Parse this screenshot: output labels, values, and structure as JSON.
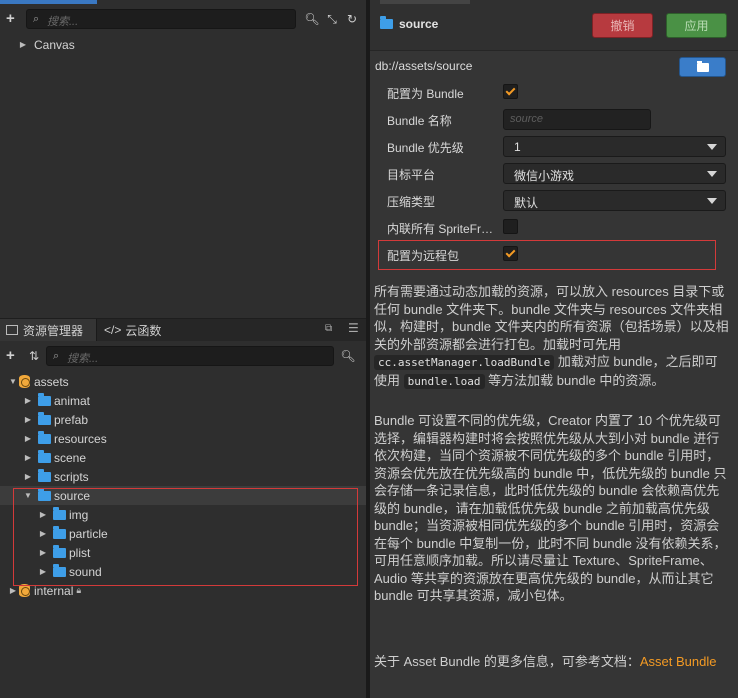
{
  "hierarchy": {
    "search_placeholder": "搜索...",
    "items": [
      {
        "label": "Canvas"
      }
    ]
  },
  "assets_panel": {
    "tabs": [
      {
        "label": "资源管理器"
      },
      {
        "label": "云函数"
      }
    ],
    "search_placeholder": "搜索...",
    "tree": [
      {
        "label": "assets"
      },
      {
        "label": "animat"
      },
      {
        "label": "prefab"
      },
      {
        "label": "resources"
      },
      {
        "label": "scene"
      },
      {
        "label": "scripts"
      },
      {
        "label": "source"
      },
      {
        "label": "img"
      },
      {
        "label": "particle"
      },
      {
        "label": "plist"
      },
      {
        "label": "sound"
      },
      {
        "label": "internal"
      }
    ]
  },
  "inspector": {
    "title": "source",
    "cancel_label": "撤销",
    "apply_label": "应用",
    "path": "db://assets/source",
    "props": [
      {
        "label": "配置为 Bundle",
        "checked": true
      },
      {
        "label": "Bundle 名称",
        "placeholder": "source"
      },
      {
        "label": "Bundle 优先级",
        "value": "1"
      },
      {
        "label": "目标平台",
        "value": "微信小游戏"
      },
      {
        "label": "压缩类型",
        "value": "默认"
      },
      {
        "label": "内联所有 SpriteFrame",
        "checked": false
      },
      {
        "label": "配置为远程包",
        "checked": true
      }
    ],
    "desc1_a": "所有需要通过动态加载的资源，可以放入 resources 目录下或任何 bundle 文件夹下。bundle 文件夹与 resources 文件夹相似，构建时，bundle 文件夹内的所有资源（包括场景）以及相关的外部资源都会进行打包。加载时可先用",
    "desc1_code1": "cc.assetManager.loadBundle",
    "desc1_b": "加载对应 bundle，之后即可使用",
    "desc1_code2": "bundle.load",
    "desc1_c": "等方法加载 bundle 中的资源。",
    "desc2": "Bundle 可设置不同的优先级，Creator 内置了 10 个优先级可选择，编辑器构建时将会按照优先级从大到小对 bundle 进行依次构建，当同个资源被不同优先级的多个 bundle 引用时，资源会优先放在优先级高的 bundle 中，低优先级的 bundle 只会存储一条记录信息，此时低优先级的 bundle 会依赖高优先级的 bundle，请在加载低优先级 bundle 之前加载高优先级 bundle；当资源被相同优先级的多个 bundle 引用时，资源会在每个 bundle 中复制一份，此时不同 bundle 没有依赖关系，可用任意顺序加载。所以请尽量让 Texture、SpriteFrame、Audio 等共享的资源放在更高优先级的 bundle，从而让其它 bundle 可共享其资源，减小包体。",
    "desc3_text": "关于 Asset Bundle 的更多信息，可参考文档：",
    "desc3_link": "Asset Bundle"
  },
  "colors": {
    "accent_blue": "#3a78c2",
    "checkbox_orange": "#f39a24",
    "cancel_red": "#b73a3f",
    "apply_green": "#4a9145",
    "highlight_red": "#d33a3a",
    "folder_blue": "#3e9ee8"
  }
}
